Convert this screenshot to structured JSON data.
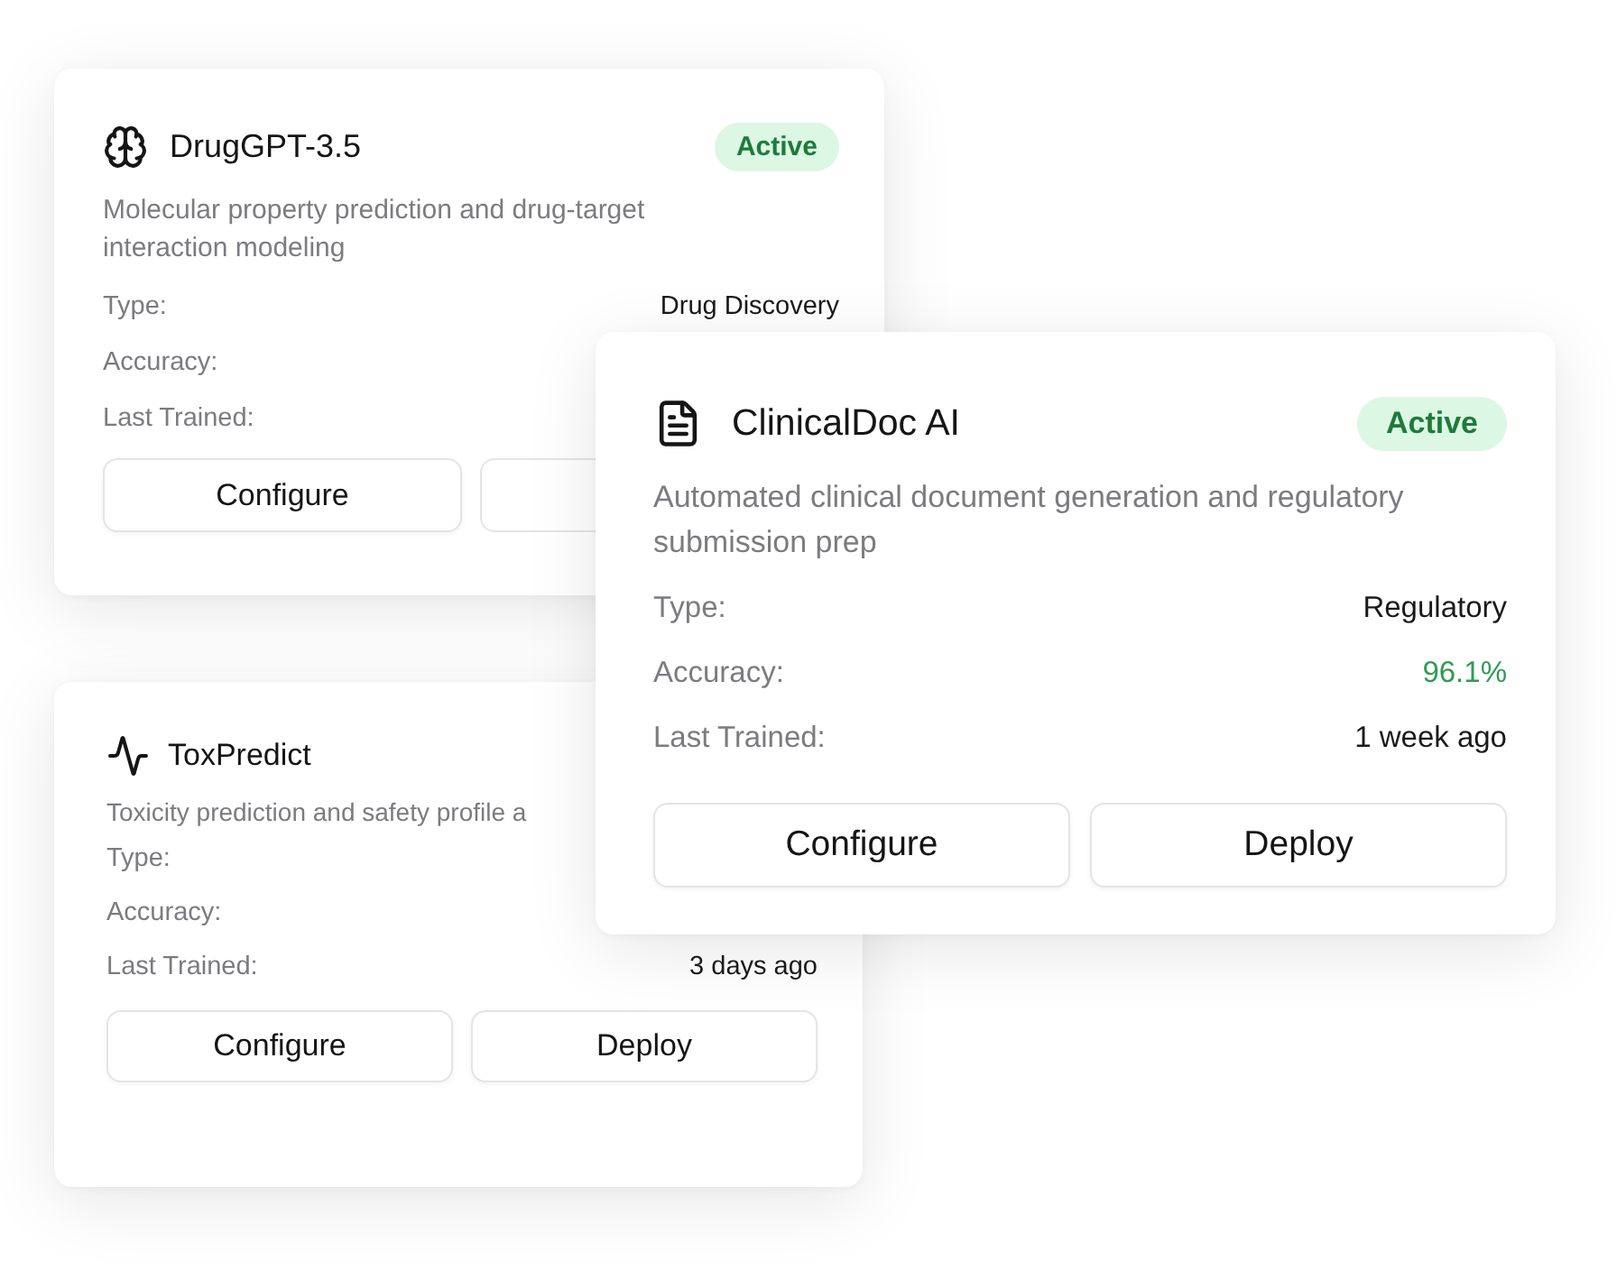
{
  "cards": [
    {
      "title": "DrugGPT-3.5",
      "status": "Active",
      "description": "Molecular property prediction and drug-target interaction modeling",
      "rows": [
        {
          "label": "Type:",
          "value": "Drug Discovery",
          "positive": false
        },
        {
          "label": "Accuracy:"
        },
        {
          "label": "Last Trained:"
        }
      ],
      "buttons": [
        {
          "kind": "full",
          "label": "Configure"
        },
        {
          "kind": "cut"
        }
      ]
    },
    {
      "title": "ToxPredict",
      "description": "Toxicity prediction and safety profile a",
      "rows": [
        {
          "label": "Type:"
        },
        {
          "label": "Accuracy:"
        },
        {
          "label": "Last Trained:",
          "value": "3 days ago",
          "positive": false
        }
      ],
      "buttons": [
        {
          "kind": "full",
          "label": "Configure"
        },
        {
          "kind": "full",
          "label": "Deploy"
        }
      ]
    },
    {
      "title": "ClinicalDoc AI",
      "status": "Active",
      "description": "Automated clinical document generation and regulatory submission prep",
      "rows": [
        {
          "label": "Type:",
          "value": "Regulatory",
          "positive": false
        },
        {
          "label": "Accuracy:",
          "value": "96.1%",
          "positive": true
        },
        {
          "label": "Last Trained:",
          "value": "1 week ago",
          "positive": false
        }
      ],
      "buttons": [
        {
          "kind": "full",
          "label": "Configure"
        },
        {
          "kind": "full",
          "label": "Deploy"
        }
      ]
    }
  ]
}
